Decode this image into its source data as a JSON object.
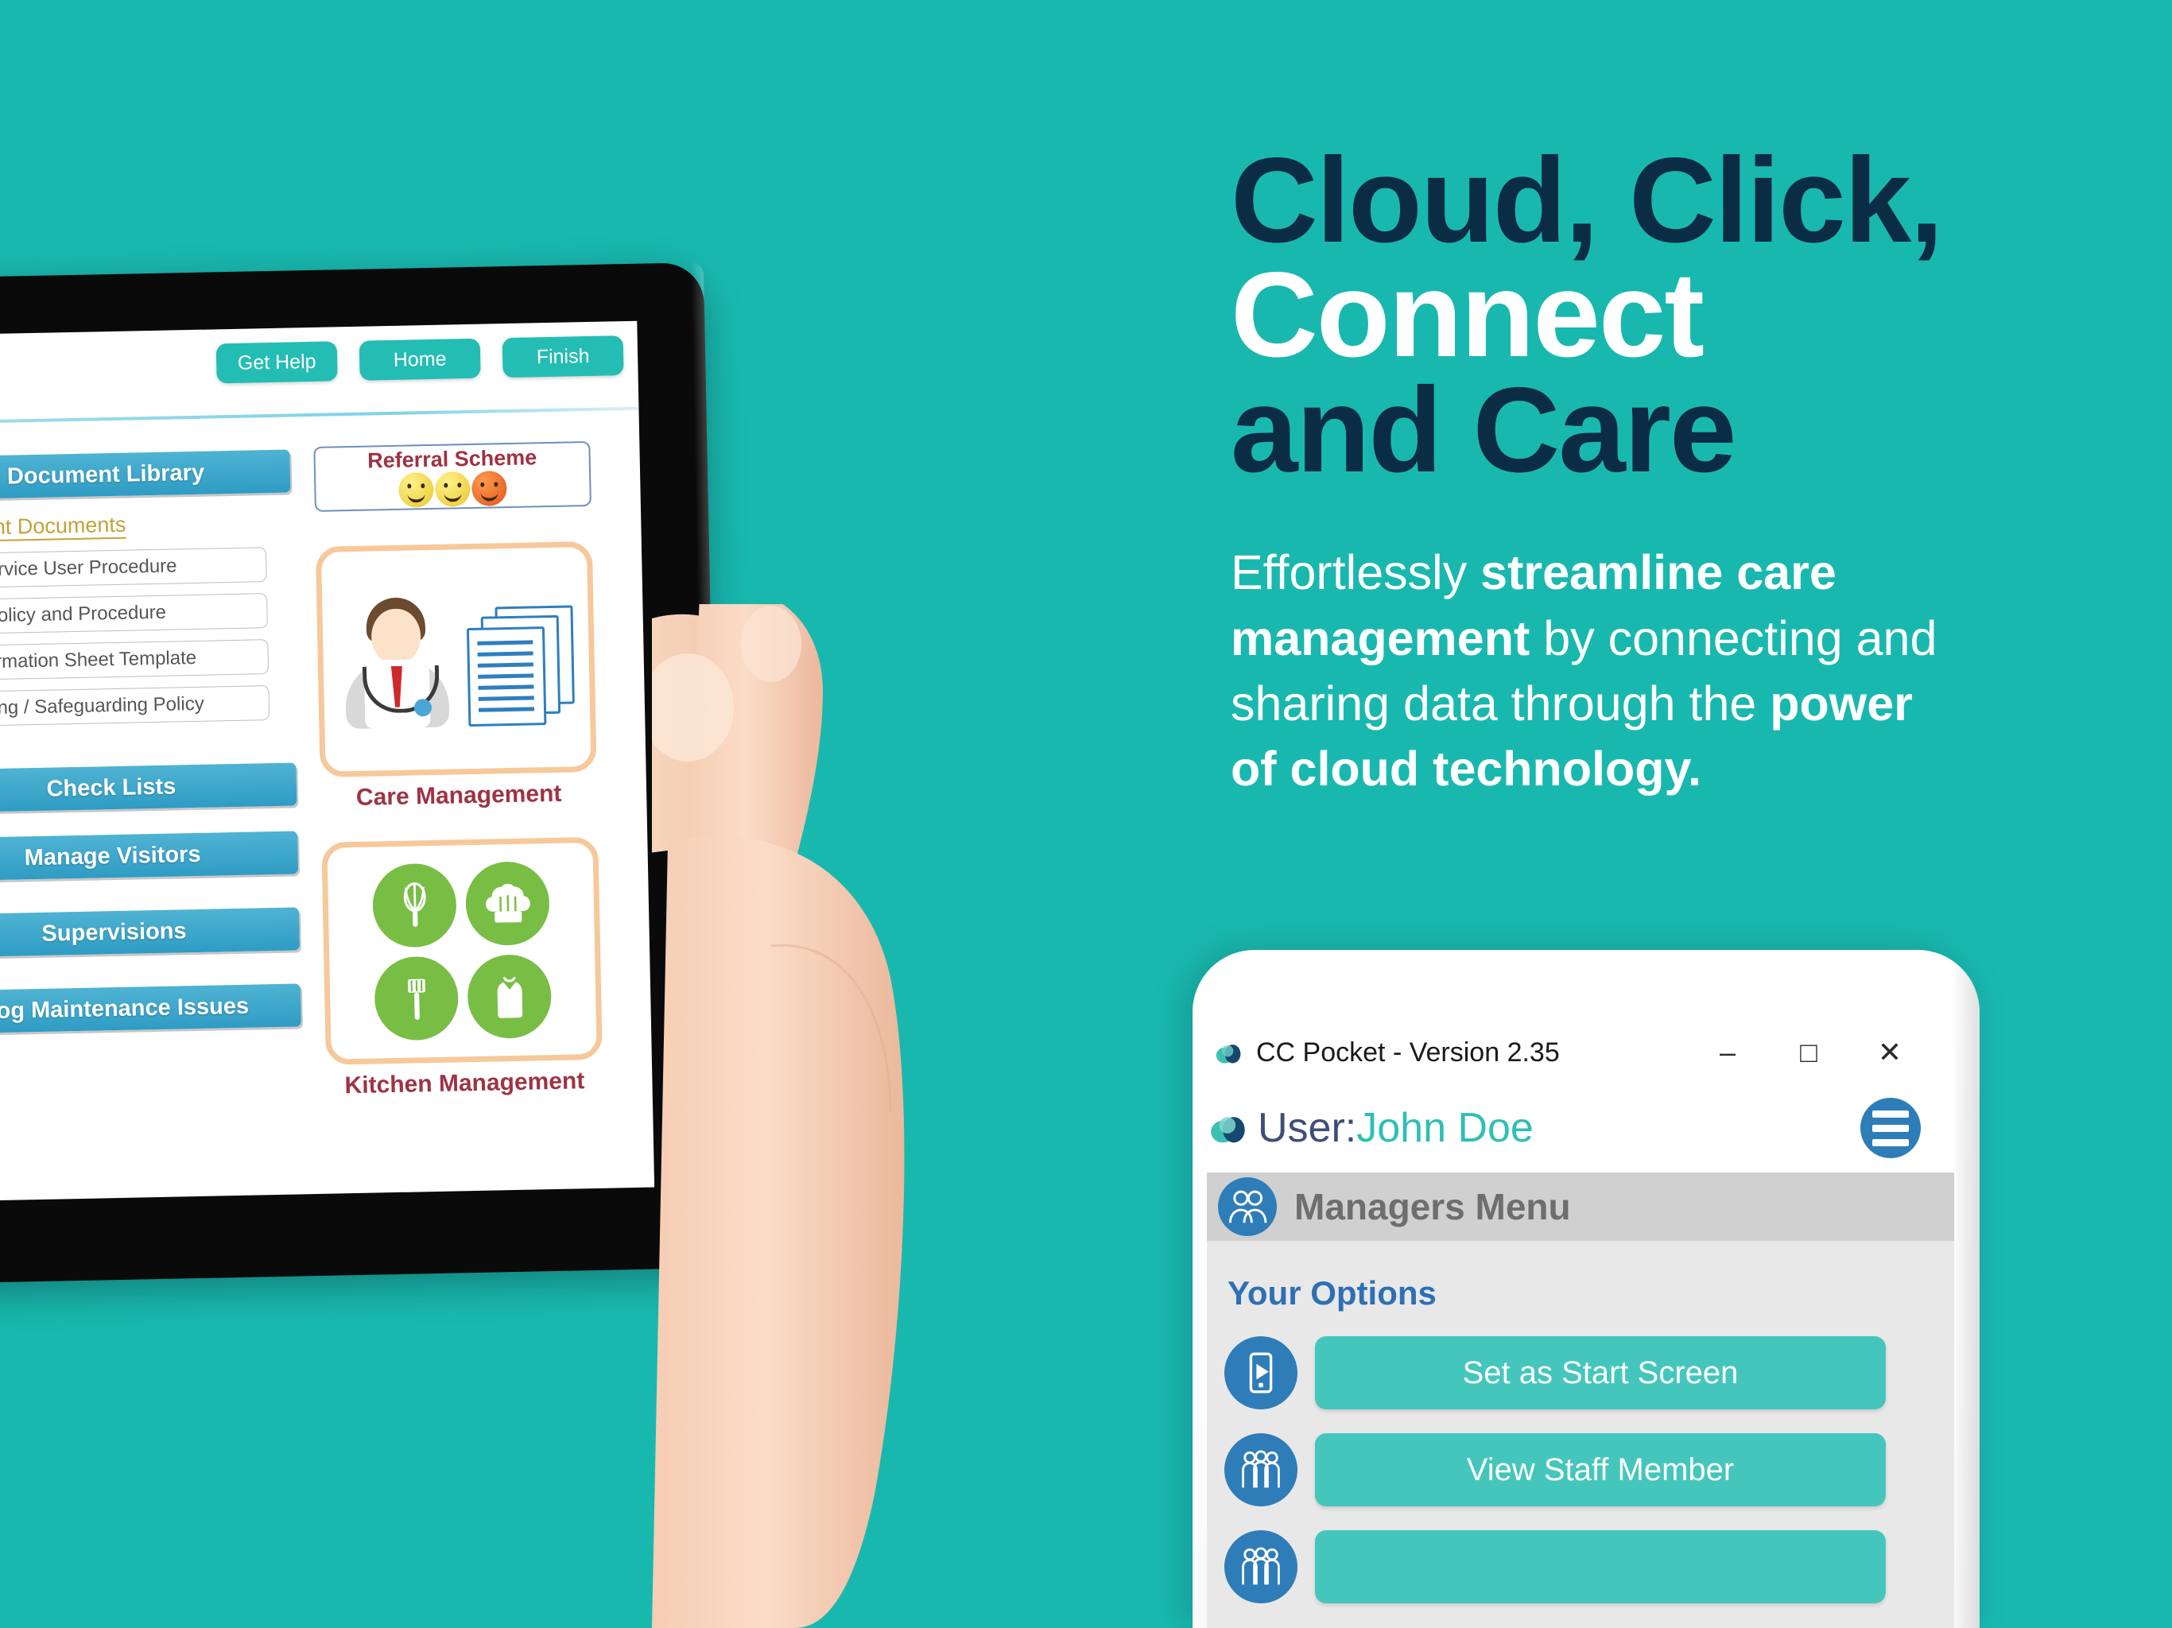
{
  "theme": {
    "background": "#19B8AF",
    "headline_dark": "#0B2C45",
    "headline_light": "#FFFFFF",
    "button_teal": "#45C6BC",
    "icon_blue": "#2E7DB8",
    "tablet_blue_bar": "#2F9CC4",
    "kitchen_green": "#78BE45",
    "card_orange": "#F6C89A",
    "caption_maroon": "#9E3344"
  },
  "marketing": {
    "headline_line1": "Cloud, Click,",
    "headline_line2": "Connect",
    "headline_line3": "and Care",
    "body_parts": [
      {
        "text": "Effortlessly ",
        "bold": false
      },
      {
        "text": "streamline care management",
        "bold": true
      },
      {
        "text": " by connecting and sharing data through the ",
        "bold": false
      },
      {
        "text": "power of cloud technology.",
        "bold": true
      }
    ]
  },
  "tablet": {
    "toolbar": [
      {
        "label": "Get Help",
        "name": "get-help-button"
      },
      {
        "label": "Home",
        "name": "home-button"
      },
      {
        "label": "Finish",
        "name": "finish-button"
      }
    ],
    "left_column": {
      "document_library": {
        "label": "Document Library",
        "icon": "reader-icon",
        "subheading": "Important Documents",
        "documents": [
          "Death of a Service User Procedure",
          "Disciplinary Policy and Procedure",
          "Resident Information Sheet Template",
          "Whistle Blowing / Safeguarding Policy"
        ]
      },
      "menu_items": [
        {
          "label": "Check Lists",
          "icon": "clipboard-medical-icon"
        },
        {
          "label": "Manage Visitors",
          "icon": "open-book-icon"
        },
        {
          "label": "Supervisions",
          "icon": "two-people-icon"
        },
        {
          "label": "Log Maintenance Issues",
          "icon": "gear-icon"
        }
      ]
    },
    "right_column": {
      "referral_scheme": {
        "title": "Referral Scheme",
        "icon": "smiley-faces-icon"
      },
      "care_management": {
        "caption": "Care Management",
        "icon": "doctor-documents-icon"
      },
      "kitchen_management": {
        "caption": "Kitchen Management",
        "icons": [
          "whisk-icon",
          "chef-hat-icon",
          "spatula-icon",
          "apron-icon"
        ]
      }
    }
  },
  "phone_app": {
    "window": {
      "title": "CC Pocket - Version 2.35",
      "app_icon": "cloud-icon",
      "minimize": "–",
      "maximize": "□",
      "close": "✕"
    },
    "user_bar": {
      "icon": "cloud-icon",
      "label": "User:",
      "user_name": "John Doe",
      "menu_icon": "hamburger-icon"
    },
    "menu_header": {
      "title": "Managers Menu",
      "icon": "two-people-icon"
    },
    "options_heading": "Your Options",
    "options": [
      {
        "label": "Set as Start Screen",
        "icon": "phone-play-icon"
      },
      {
        "label": "View Staff Member",
        "icon": "staff-group-icon"
      },
      {
        "label": "",
        "icon": "staff-group-icon"
      }
    ]
  }
}
